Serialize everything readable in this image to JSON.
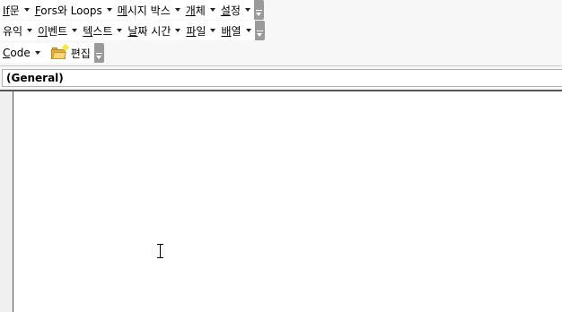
{
  "toolbar1": {
    "items": [
      {
        "accel": "If",
        "rest": "문"
      },
      {
        "accel": "F",
        "rest": "ors와 Loops"
      },
      {
        "accel": "메",
        "rest": "시지 박스"
      },
      {
        "accel": "개",
        "rest": "체"
      },
      {
        "accel": "설",
        "rest": "정"
      }
    ]
  },
  "toolbar2": {
    "items": [
      {
        "accel": "",
        "rest": "유익"
      },
      {
        "accel": "이",
        "rest": "벤트"
      },
      {
        "accel": "텍",
        "rest": "스트"
      },
      {
        "accel": "날",
        "rest": "짜 시간"
      },
      {
        "accel": "파",
        "rest": "일"
      },
      {
        "accel": "배",
        "rest": "열"
      }
    ]
  },
  "toolbar3": {
    "code_accel": "C",
    "code_rest": "ode",
    "edit_label": "편집",
    "edit_icon": "folder-open-icon"
  },
  "combo": {
    "value": "(General)"
  }
}
